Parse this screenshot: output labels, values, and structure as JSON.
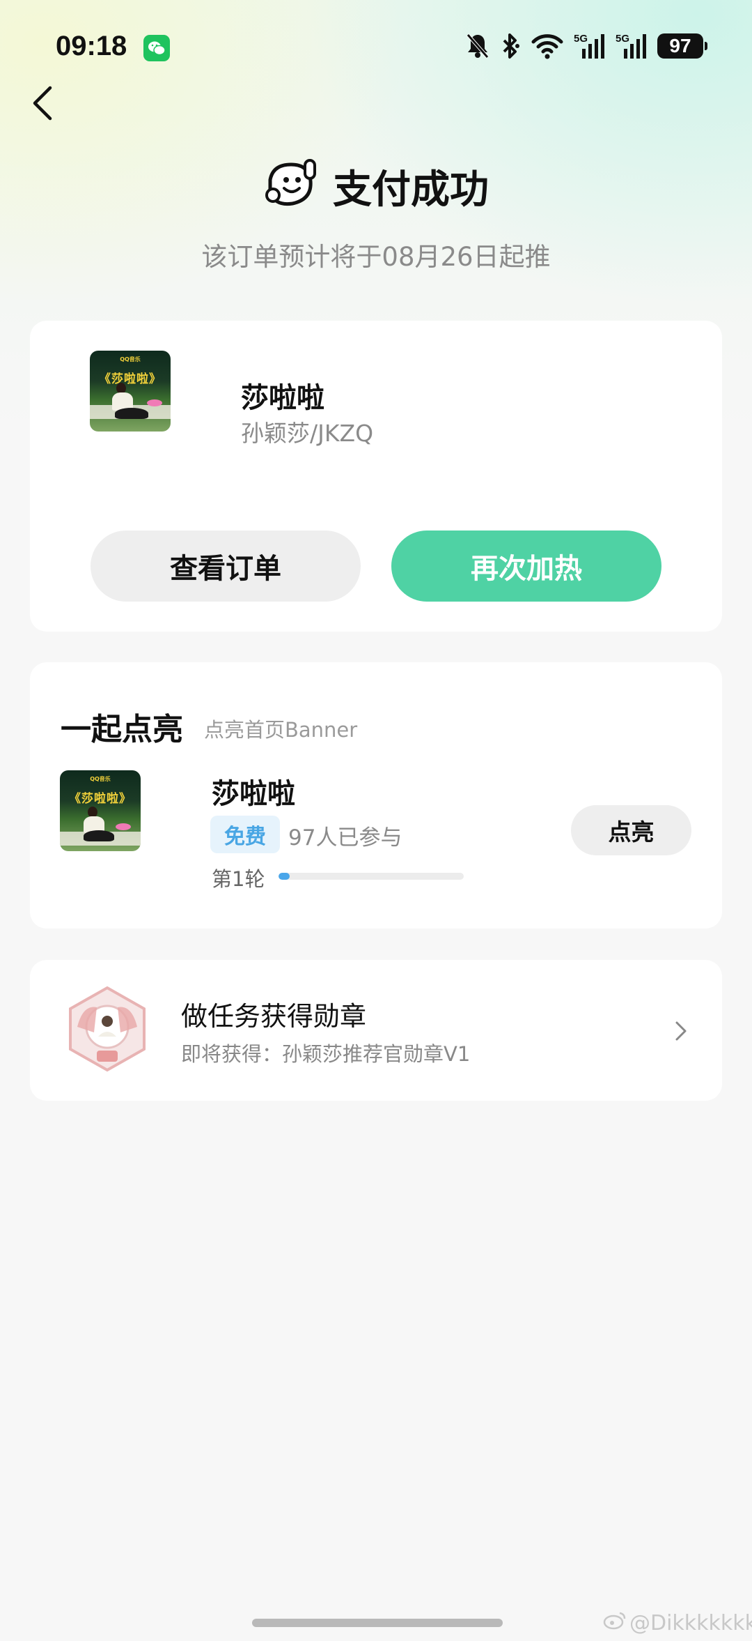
{
  "status_bar": {
    "time": "09:18",
    "battery": "97",
    "icons": [
      "wechat-icon",
      "mute-bell-icon",
      "bluetooth-icon",
      "wifi-icon",
      "5g-signal-icon",
      "5g-signal-icon",
      "battery-icon"
    ]
  },
  "header": {
    "back_icon": "chevron-left-icon",
    "title": "支付成功",
    "subtitle": "该订单预计将于08月26日起推"
  },
  "order_card": {
    "song_title": "莎啦啦",
    "artist": "孙颖莎/JKZQ",
    "cover_text": "《莎啦啦》",
    "view_order_label": "查看订单",
    "boost_again_label": "再次加热"
  },
  "light_card": {
    "heading": "一起点亮",
    "subheading": "点亮首页Banner",
    "song_title": "莎啦啦",
    "cover_text": "《莎啦啦》",
    "free_badge": "免费",
    "participants": "97人已参与",
    "round": "第1轮",
    "progress": 0.06,
    "light_button": "点亮"
  },
  "task_card": {
    "title": "做任务获得勋章",
    "subtitle": "即将获得：孙颖莎推荐官勋章V1"
  },
  "watermark": "@Dikkkkkkkk",
  "colors": {
    "accent_green": "#4fd2a4",
    "badge_blue": "#49a6e4",
    "progress_blue": "#4aa6ea",
    "background": "#f7f7f7"
  }
}
